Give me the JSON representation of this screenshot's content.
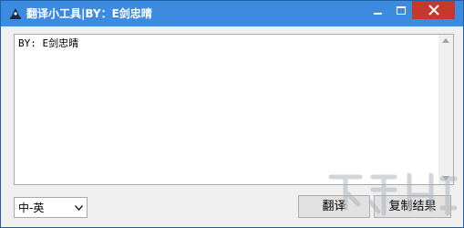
{
  "window": {
    "title": "翻译小工具|BY：E剑忠晴"
  },
  "textarea": {
    "content": "BY: E剑忠晴"
  },
  "language_select": {
    "value": "中-英"
  },
  "buttons": {
    "translate": "翻译",
    "copy_result": "复制结果"
  },
  "colors": {
    "titlebar": "#3c8be0",
    "close_button": "#c7372d"
  }
}
